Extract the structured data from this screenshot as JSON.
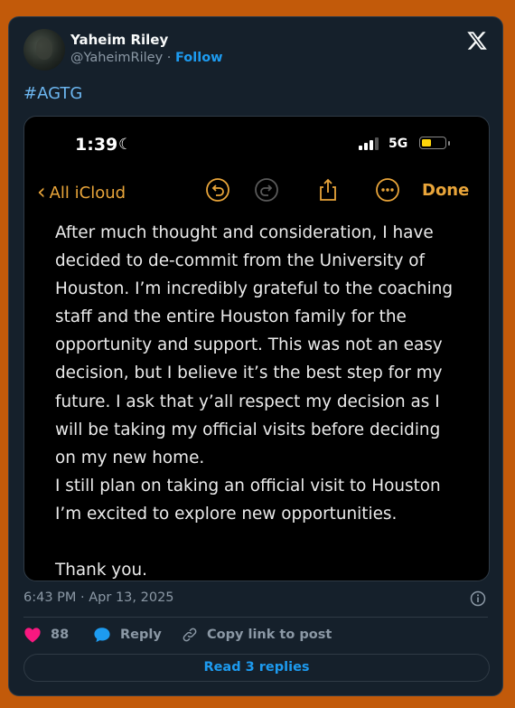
{
  "author": {
    "name": "Yaheim Riley",
    "handle": "@YaheimRiley",
    "separator": "·",
    "follow_label": "Follow"
  },
  "tweet": {
    "hashtag": "#AGTG",
    "timestamp": "6:43 PM · Apr 13, 2025"
  },
  "screenshot": {
    "status_time": "1:39",
    "network": "5G",
    "back_label": "All iCloud",
    "done_label": "Done",
    "note_text": "After much thought and consideration, I have\ndecided to de-commit from the University of\nHouston.  I’m incredibly grateful to the coaching\nstaff and the entire Houston family for the\nopportunity and support. This was not an easy\ndecision, but I believe it’s the best step for my\nfuture. I ask that y’all respect my decision as I\nwill be taking my official visits before deciding\non my new home.\nI still plan on taking an official visit to Houston\nI’m excited to explore new opportunities.\n\nThank you."
  },
  "actions": {
    "like_count": "88",
    "reply_label": "Reply",
    "copy_label": "Copy link to post"
  },
  "read_replies_label": "Read 3 replies",
  "colors": {
    "page_bg": "#c25a0a",
    "card_bg": "#15202b",
    "accent": "#1d9bf0",
    "like": "#f91880",
    "notes_accent": "#e9a53a"
  },
  "icons": [
    "x-logo-icon",
    "moon-icon",
    "signal-icon",
    "battery-icon",
    "chevron-left-icon",
    "undo-icon",
    "redo-icon",
    "share-icon",
    "more-icon",
    "info-icon",
    "heart-icon",
    "reply-bubble-icon",
    "link-icon"
  ]
}
